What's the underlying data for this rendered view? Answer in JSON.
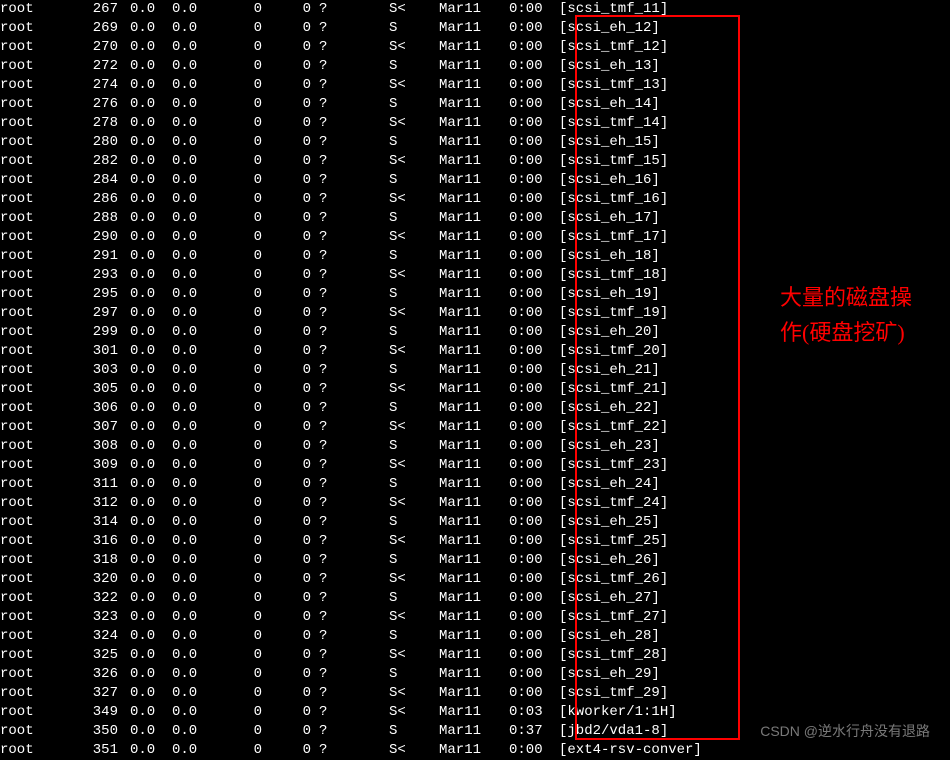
{
  "annotation_text": "大量的磁盘操作(硬盘挖矿)",
  "watermark_text": "CSDN @逆水行舟没有退路",
  "rows": [
    {
      "user": "root",
      "pid": "267",
      "cpu": "0.0",
      "mem": "0.0",
      "vsz": "0",
      "rss": "0",
      "tty": "?",
      "stat": "S<",
      "start": "Mar11",
      "time": "0:00",
      "cmd": "[scsi_tmf_11]"
    },
    {
      "user": "root",
      "pid": "269",
      "cpu": "0.0",
      "mem": "0.0",
      "vsz": "0",
      "rss": "0",
      "tty": "?",
      "stat": "S",
      "start": "Mar11",
      "time": "0:00",
      "cmd": "[scsi_eh_12]"
    },
    {
      "user": "root",
      "pid": "270",
      "cpu": "0.0",
      "mem": "0.0",
      "vsz": "0",
      "rss": "0",
      "tty": "?",
      "stat": "S<",
      "start": "Mar11",
      "time": "0:00",
      "cmd": "[scsi_tmf_12]"
    },
    {
      "user": "root",
      "pid": "272",
      "cpu": "0.0",
      "mem": "0.0",
      "vsz": "0",
      "rss": "0",
      "tty": "?",
      "stat": "S",
      "start": "Mar11",
      "time": "0:00",
      "cmd": "[scsi_eh_13]"
    },
    {
      "user": "root",
      "pid": "274",
      "cpu": "0.0",
      "mem": "0.0",
      "vsz": "0",
      "rss": "0",
      "tty": "?",
      "stat": "S<",
      "start": "Mar11",
      "time": "0:00",
      "cmd": "[scsi_tmf_13]"
    },
    {
      "user": "root",
      "pid": "276",
      "cpu": "0.0",
      "mem": "0.0",
      "vsz": "0",
      "rss": "0",
      "tty": "?",
      "stat": "S",
      "start": "Mar11",
      "time": "0:00",
      "cmd": "[scsi_eh_14]"
    },
    {
      "user": "root",
      "pid": "278",
      "cpu": "0.0",
      "mem": "0.0",
      "vsz": "0",
      "rss": "0",
      "tty": "?",
      "stat": "S<",
      "start": "Mar11",
      "time": "0:00",
      "cmd": "[scsi_tmf_14]"
    },
    {
      "user": "root",
      "pid": "280",
      "cpu": "0.0",
      "mem": "0.0",
      "vsz": "0",
      "rss": "0",
      "tty": "?",
      "stat": "S",
      "start": "Mar11",
      "time": "0:00",
      "cmd": "[scsi_eh_15]"
    },
    {
      "user": "root",
      "pid": "282",
      "cpu": "0.0",
      "mem": "0.0",
      "vsz": "0",
      "rss": "0",
      "tty": "?",
      "stat": "S<",
      "start": "Mar11",
      "time": "0:00",
      "cmd": "[scsi_tmf_15]"
    },
    {
      "user": "root",
      "pid": "284",
      "cpu": "0.0",
      "mem": "0.0",
      "vsz": "0",
      "rss": "0",
      "tty": "?",
      "stat": "S",
      "start": "Mar11",
      "time": "0:00",
      "cmd": "[scsi_eh_16]"
    },
    {
      "user": "root",
      "pid": "286",
      "cpu": "0.0",
      "mem": "0.0",
      "vsz": "0",
      "rss": "0",
      "tty": "?",
      "stat": "S<",
      "start": "Mar11",
      "time": "0:00",
      "cmd": "[scsi_tmf_16]"
    },
    {
      "user": "root",
      "pid": "288",
      "cpu": "0.0",
      "mem": "0.0",
      "vsz": "0",
      "rss": "0",
      "tty": "?",
      "stat": "S",
      "start": "Mar11",
      "time": "0:00",
      "cmd": "[scsi_eh_17]"
    },
    {
      "user": "root",
      "pid": "290",
      "cpu": "0.0",
      "mem": "0.0",
      "vsz": "0",
      "rss": "0",
      "tty": "?",
      "stat": "S<",
      "start": "Mar11",
      "time": "0:00",
      "cmd": "[scsi_tmf_17]"
    },
    {
      "user": "root",
      "pid": "291",
      "cpu": "0.0",
      "mem": "0.0",
      "vsz": "0",
      "rss": "0",
      "tty": "?",
      "stat": "S",
      "start": "Mar11",
      "time": "0:00",
      "cmd": "[scsi_eh_18]"
    },
    {
      "user": "root",
      "pid": "293",
      "cpu": "0.0",
      "mem": "0.0",
      "vsz": "0",
      "rss": "0",
      "tty": "?",
      "stat": "S<",
      "start": "Mar11",
      "time": "0:00",
      "cmd": "[scsi_tmf_18]"
    },
    {
      "user": "root",
      "pid": "295",
      "cpu": "0.0",
      "mem": "0.0",
      "vsz": "0",
      "rss": "0",
      "tty": "?",
      "stat": "S",
      "start": "Mar11",
      "time": "0:00",
      "cmd": "[scsi_eh_19]"
    },
    {
      "user": "root",
      "pid": "297",
      "cpu": "0.0",
      "mem": "0.0",
      "vsz": "0",
      "rss": "0",
      "tty": "?",
      "stat": "S<",
      "start": "Mar11",
      "time": "0:00",
      "cmd": "[scsi_tmf_19]"
    },
    {
      "user": "root",
      "pid": "299",
      "cpu": "0.0",
      "mem": "0.0",
      "vsz": "0",
      "rss": "0",
      "tty": "?",
      "stat": "S",
      "start": "Mar11",
      "time": "0:00",
      "cmd": "[scsi_eh_20]"
    },
    {
      "user": "root",
      "pid": "301",
      "cpu": "0.0",
      "mem": "0.0",
      "vsz": "0",
      "rss": "0",
      "tty": "?",
      "stat": "S<",
      "start": "Mar11",
      "time": "0:00",
      "cmd": "[scsi_tmf_20]"
    },
    {
      "user": "root",
      "pid": "303",
      "cpu": "0.0",
      "mem": "0.0",
      "vsz": "0",
      "rss": "0",
      "tty": "?",
      "stat": "S",
      "start": "Mar11",
      "time": "0:00",
      "cmd": "[scsi_eh_21]"
    },
    {
      "user": "root",
      "pid": "305",
      "cpu": "0.0",
      "mem": "0.0",
      "vsz": "0",
      "rss": "0",
      "tty": "?",
      "stat": "S<",
      "start": "Mar11",
      "time": "0:00",
      "cmd": "[scsi_tmf_21]"
    },
    {
      "user": "root",
      "pid": "306",
      "cpu": "0.0",
      "mem": "0.0",
      "vsz": "0",
      "rss": "0",
      "tty": "?",
      "stat": "S",
      "start": "Mar11",
      "time": "0:00",
      "cmd": "[scsi_eh_22]"
    },
    {
      "user": "root",
      "pid": "307",
      "cpu": "0.0",
      "mem": "0.0",
      "vsz": "0",
      "rss": "0",
      "tty": "?",
      "stat": "S<",
      "start": "Mar11",
      "time": "0:00",
      "cmd": "[scsi_tmf_22]"
    },
    {
      "user": "root",
      "pid": "308",
      "cpu": "0.0",
      "mem": "0.0",
      "vsz": "0",
      "rss": "0",
      "tty": "?",
      "stat": "S",
      "start": "Mar11",
      "time": "0:00",
      "cmd": "[scsi_eh_23]"
    },
    {
      "user": "root",
      "pid": "309",
      "cpu": "0.0",
      "mem": "0.0",
      "vsz": "0",
      "rss": "0",
      "tty": "?",
      "stat": "S<",
      "start": "Mar11",
      "time": "0:00",
      "cmd": "[scsi_tmf_23]"
    },
    {
      "user": "root",
      "pid": "311",
      "cpu": "0.0",
      "mem": "0.0",
      "vsz": "0",
      "rss": "0",
      "tty": "?",
      "stat": "S",
      "start": "Mar11",
      "time": "0:00",
      "cmd": "[scsi_eh_24]"
    },
    {
      "user": "root",
      "pid": "312",
      "cpu": "0.0",
      "mem": "0.0",
      "vsz": "0",
      "rss": "0",
      "tty": "?",
      "stat": "S<",
      "start": "Mar11",
      "time": "0:00",
      "cmd": "[scsi_tmf_24]"
    },
    {
      "user": "root",
      "pid": "314",
      "cpu": "0.0",
      "mem": "0.0",
      "vsz": "0",
      "rss": "0",
      "tty": "?",
      "stat": "S",
      "start": "Mar11",
      "time": "0:00",
      "cmd": "[scsi_eh_25]"
    },
    {
      "user": "root",
      "pid": "316",
      "cpu": "0.0",
      "mem": "0.0",
      "vsz": "0",
      "rss": "0",
      "tty": "?",
      "stat": "S<",
      "start": "Mar11",
      "time": "0:00",
      "cmd": "[scsi_tmf_25]"
    },
    {
      "user": "root",
      "pid": "318",
      "cpu": "0.0",
      "mem": "0.0",
      "vsz": "0",
      "rss": "0",
      "tty": "?",
      "stat": "S",
      "start": "Mar11",
      "time": "0:00",
      "cmd": "[scsi_eh_26]"
    },
    {
      "user": "root",
      "pid": "320",
      "cpu": "0.0",
      "mem": "0.0",
      "vsz": "0",
      "rss": "0",
      "tty": "?",
      "stat": "S<",
      "start": "Mar11",
      "time": "0:00",
      "cmd": "[scsi_tmf_26]"
    },
    {
      "user": "root",
      "pid": "322",
      "cpu": "0.0",
      "mem": "0.0",
      "vsz": "0",
      "rss": "0",
      "tty": "?",
      "stat": "S",
      "start": "Mar11",
      "time": "0:00",
      "cmd": "[scsi_eh_27]"
    },
    {
      "user": "root",
      "pid": "323",
      "cpu": "0.0",
      "mem": "0.0",
      "vsz": "0",
      "rss": "0",
      "tty": "?",
      "stat": "S<",
      "start": "Mar11",
      "time": "0:00",
      "cmd": "[scsi_tmf_27]"
    },
    {
      "user": "root",
      "pid": "324",
      "cpu": "0.0",
      "mem": "0.0",
      "vsz": "0",
      "rss": "0",
      "tty": "?",
      "stat": "S",
      "start": "Mar11",
      "time": "0:00",
      "cmd": "[scsi_eh_28]"
    },
    {
      "user": "root",
      "pid": "325",
      "cpu": "0.0",
      "mem": "0.0",
      "vsz": "0",
      "rss": "0",
      "tty": "?",
      "stat": "S<",
      "start": "Mar11",
      "time": "0:00",
      "cmd": "[scsi_tmf_28]"
    },
    {
      "user": "root",
      "pid": "326",
      "cpu": "0.0",
      "mem": "0.0",
      "vsz": "0",
      "rss": "0",
      "tty": "?",
      "stat": "S",
      "start": "Mar11",
      "time": "0:00",
      "cmd": "[scsi_eh_29]"
    },
    {
      "user": "root",
      "pid": "327",
      "cpu": "0.0",
      "mem": "0.0",
      "vsz": "0",
      "rss": "0",
      "tty": "?",
      "stat": "S<",
      "start": "Mar11",
      "time": "0:00",
      "cmd": "[scsi_tmf_29]"
    },
    {
      "user": "root",
      "pid": "349",
      "cpu": "0.0",
      "mem": "0.0",
      "vsz": "0",
      "rss": "0",
      "tty": "?",
      "stat": "S<",
      "start": "Mar11",
      "time": "0:03",
      "cmd": "[kworker/1:1H]"
    },
    {
      "user": "root",
      "pid": "350",
      "cpu": "0.0",
      "mem": "0.0",
      "vsz": "0",
      "rss": "0",
      "tty": "?",
      "stat": "S",
      "start": "Mar11",
      "time": "0:37",
      "cmd": "[jbd2/vda1-8]"
    },
    {
      "user": "root",
      "pid": "351",
      "cpu": "0.0",
      "mem": "0.0",
      "vsz": "0",
      "rss": "0",
      "tty": "?",
      "stat": "S<",
      "start": "Mar11",
      "time": "0:00",
      "cmd": "[ext4-rsv-conver]"
    }
  ]
}
